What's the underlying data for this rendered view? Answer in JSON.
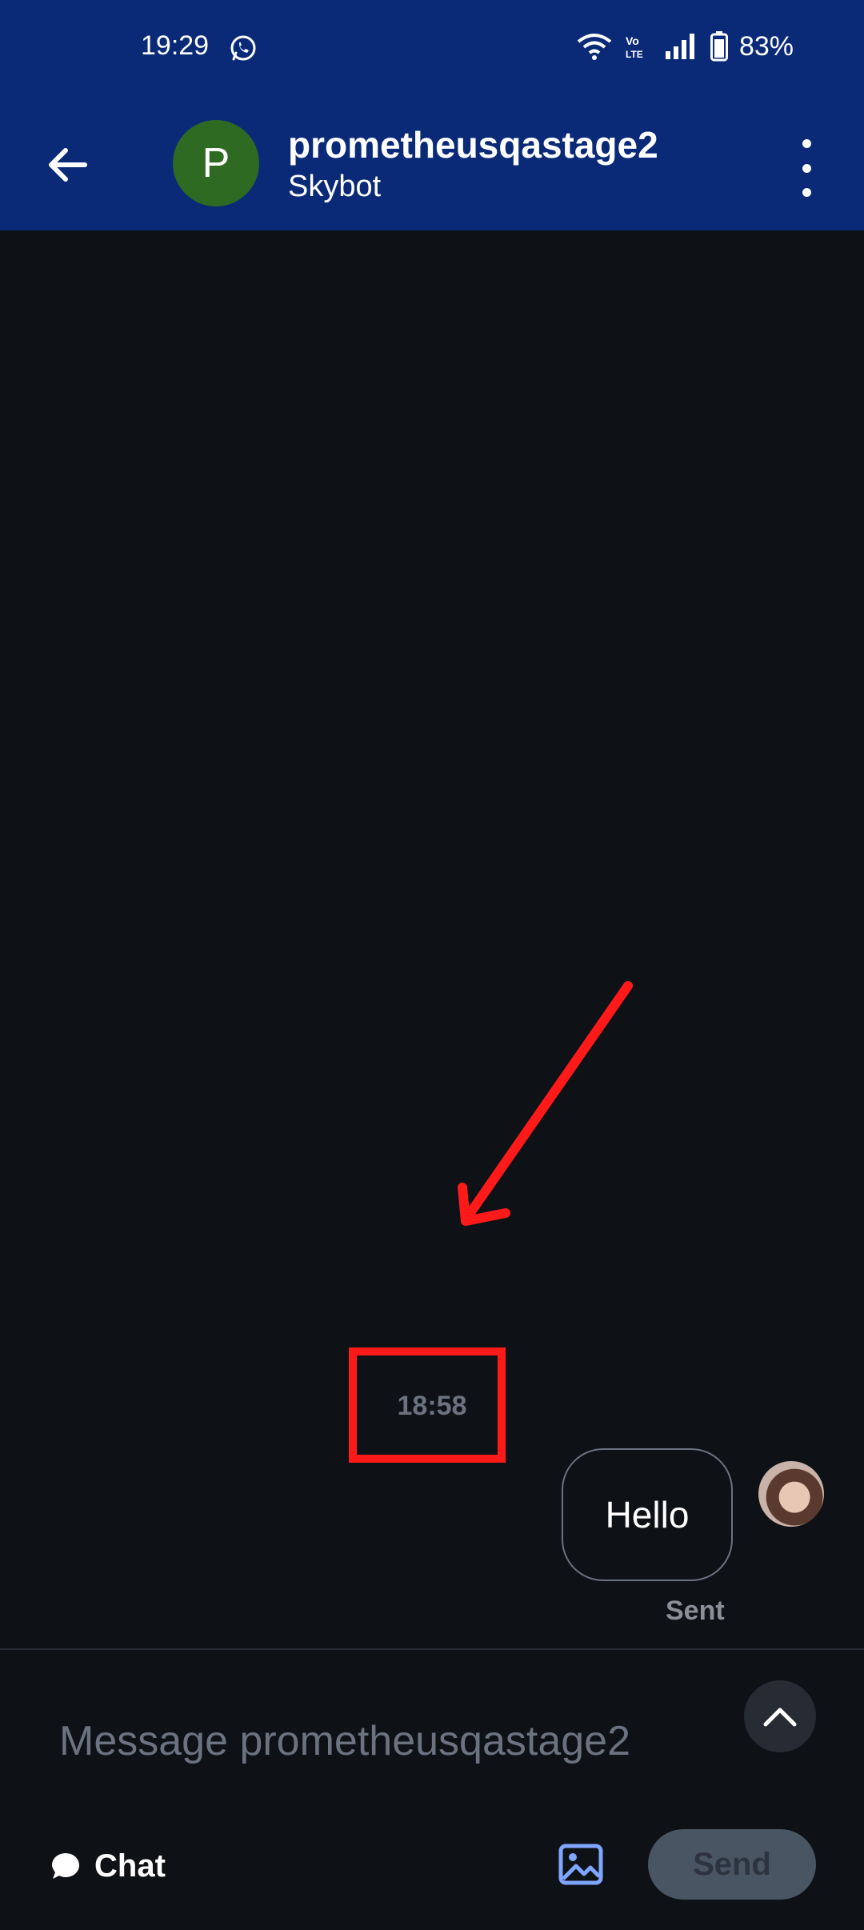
{
  "status_bar": {
    "time": "19:29",
    "battery": "83%",
    "icons": [
      "whatsapp-icon",
      "wifi-icon",
      "volte-icon",
      "signal-icon",
      "battery-icon"
    ]
  },
  "header": {
    "avatar_letter": "P",
    "title": "prometheusqastage2",
    "subtitle": "Skybot",
    "avatar_color": "#2f6a22",
    "background": "#0a2a78"
  },
  "conversation": {
    "timestamp": "18:58",
    "messages": [
      {
        "text": "Hello",
        "status": "Sent"
      }
    ]
  },
  "composer": {
    "placeholder": "Message prometheusqastage2"
  },
  "bottom_bar": {
    "chat_label": "Chat",
    "send_label": "Send"
  },
  "annotation": {
    "color": "#ff1a1a"
  }
}
